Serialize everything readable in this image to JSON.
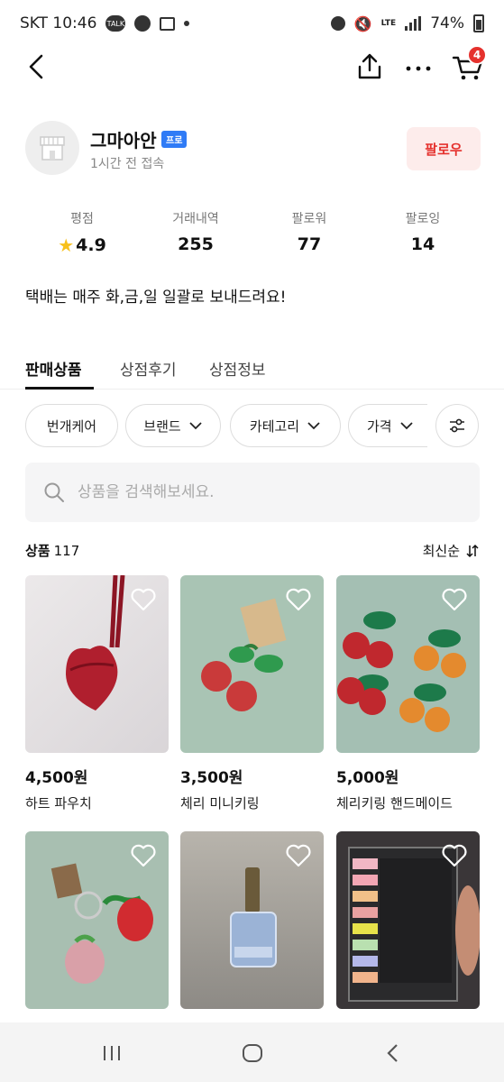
{
  "status_bar": {
    "carrier_time": "SKT 10:46",
    "talk": "TALK",
    "lte": "LTE",
    "battery": "74%"
  },
  "header": {
    "cart_count": "4"
  },
  "shop": {
    "name": "그마아안",
    "badge": "프로",
    "last_seen": "1시간 전 접속",
    "follow_label": "팔로우",
    "intro": "택배는 매주 화,금,일 일괄로 보내드려요!"
  },
  "stats": [
    {
      "label": "평점",
      "value": "4.9"
    },
    {
      "label": "거래내역",
      "value": "255"
    },
    {
      "label": "팔로워",
      "value": "77"
    },
    {
      "label": "팔로잉",
      "value": "14"
    }
  ],
  "tabs": [
    {
      "label": "판매상품",
      "active": true
    },
    {
      "label": "상점후기"
    },
    {
      "label": "상점정보"
    }
  ],
  "filters": [
    "번개케어",
    "브랜드",
    "카테고리",
    "가격"
  ],
  "search": {
    "placeholder": "상품을 검색해보세요."
  },
  "products_header": {
    "label": "상품",
    "count": "117",
    "sort": "최신순"
  },
  "products": [
    {
      "price": "4,500원",
      "name": "하트 파우치"
    },
    {
      "price": "3,500원",
      "name": "체리 미니키링"
    },
    {
      "price": "5,000원",
      "name": "체리키링 핸드메이드"
    },
    {
      "price": "",
      "name": ""
    },
    {
      "price": "",
      "name": ""
    },
    {
      "price": "",
      "name": ""
    }
  ]
}
